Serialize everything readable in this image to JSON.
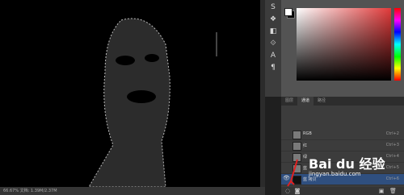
{
  "status": {
    "text": "66.67%   文档: 1.39M/2.37M"
  },
  "tools": [
    "S",
    "❖",
    "◧",
    "⟐",
    "A",
    "¶"
  ],
  "colors": {
    "foreground": "#ffffff",
    "background": "#000000"
  },
  "panel": {
    "tabs": [
      "图层",
      "通道",
      "路径"
    ],
    "active_tab": 1,
    "rows": [
      {
        "name": "RGB",
        "shortcut": "Ctrl+2",
        "visible": false,
        "selected": false
      },
      {
        "name": "红",
        "shortcut": "Ctrl+3",
        "visible": false,
        "selected": false
      },
      {
        "name": "绿",
        "shortcut": "Ctrl+4",
        "visible": false,
        "selected": false
      },
      {
        "name": "蓝",
        "shortcut": "Ctrl+5",
        "visible": false,
        "selected": false
      },
      {
        "name": "蓝 拷贝",
        "shortcut": "Ctrl+6",
        "visible": true,
        "selected": true
      }
    ]
  },
  "watermark": {
    "brand": "Bai du 经验",
    "sub": "jingyan.baidu.com"
  }
}
